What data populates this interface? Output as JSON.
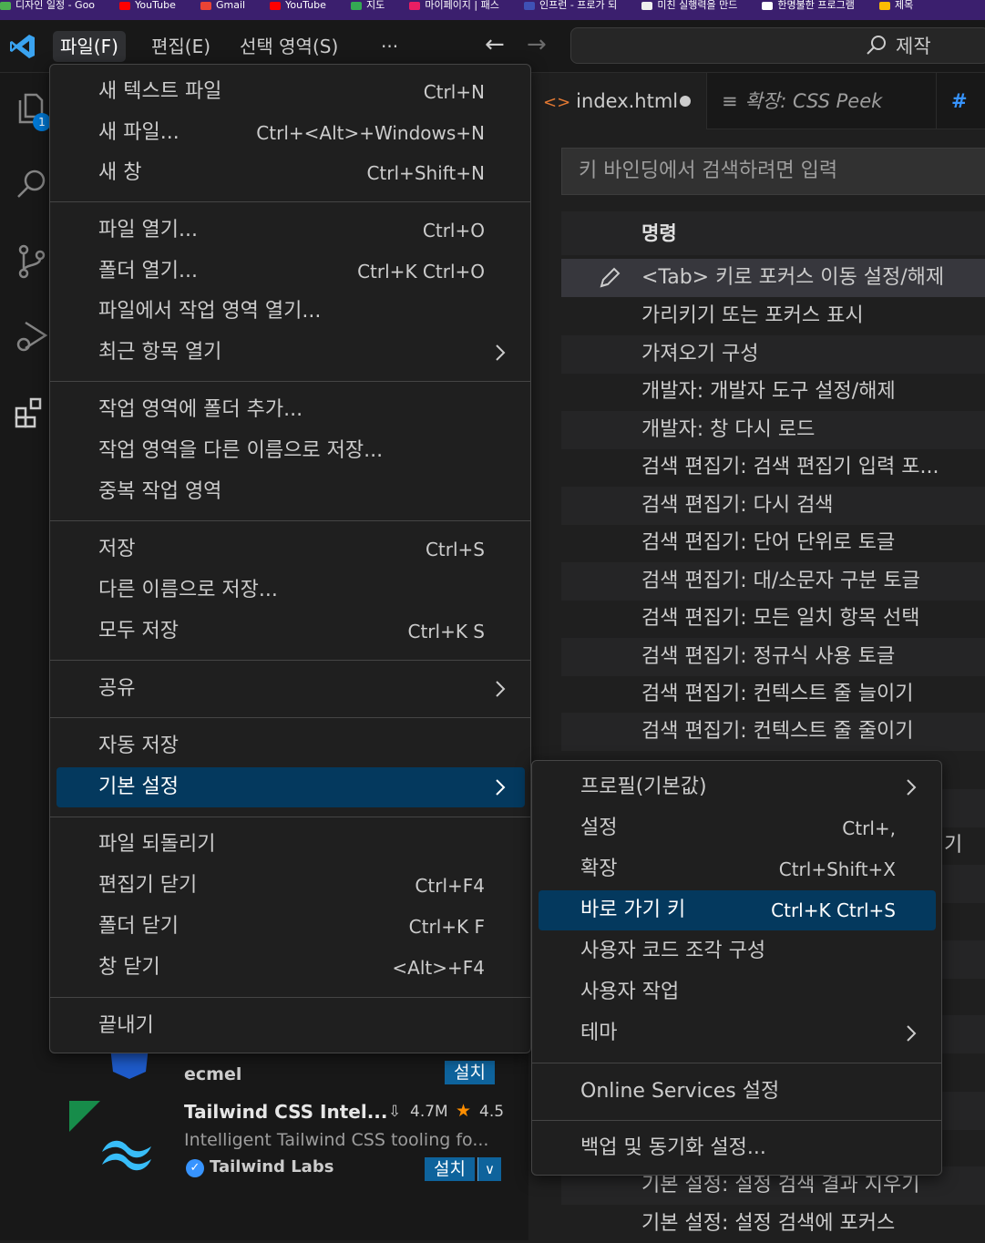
{
  "bookmarks": [
    {
      "label": "디자인 일정 - Goo",
      "color": "#4caf50"
    },
    {
      "label": "YouTube",
      "color": "#ff0000"
    },
    {
      "label": "Gmail",
      "color": "#ea4335"
    },
    {
      "label": "YouTube",
      "color": "#ff0000"
    },
    {
      "label": "지도",
      "color": "#34a853"
    },
    {
      "label": "마이페이지 | 패스",
      "color": "#e91e63"
    },
    {
      "label": "인프런 - 프로가 되",
      "color": "#3f51b5"
    },
    {
      "label": "미친 실행력을 만드",
      "color": "#eeeeee"
    },
    {
      "label": "한명불한 프로그램",
      "color": "#ffffff"
    },
    {
      "label": "제목",
      "color": "#fbbc04"
    }
  ],
  "titlebar": {
    "menus": {
      "file": "파일(F)",
      "edit": "편집(E)",
      "selection": "선택 영역(S)",
      "more": "···"
    },
    "search_label": "제작"
  },
  "activity": {
    "badge": "1"
  },
  "tabs": [
    {
      "label": "index.html",
      "icon": "<>"
    },
    {
      "label": "확장: CSS Peek",
      "icon": "≡"
    },
    {
      "label": "#",
      "icon": ""
    }
  ],
  "keybindings": {
    "search_placeholder": "키 바인딩에서 검색하려면 입력",
    "header": "명령",
    "rows": [
      "<Tab> 키로 포커스 이동 설정/해제",
      "가리키기 또는 포커스 표시",
      "가져오기 구성",
      "개발자: 개발자 도구 설정/해제",
      "개발자: 창 다시 로드",
      "검색 편집기: 검색 편집기 입력 포...",
      "검색 편집기: 다시 검색",
      "검색 편집기: 단어 단위로 토글",
      "검색 편집기: 대/소문자 구분 토글",
      "검색 편집기: 모든 일치 항목 선택",
      "검색 편집기: 정규식 사용 토글",
      "검색 편집기: 컨텍스트 줄 늘이기",
      "검색 편집기: 컨텍스트 줄 줄이기"
    ],
    "bottom_rows": [
      "기본 설정: 설정 검색 결과 지우기",
      "기본 설정: 설정 검색에 포커스"
    ],
    "partial_right": "기"
  },
  "extensions": [
    {
      "publisher": "ecmel",
      "install": "설치"
    },
    {
      "name": "Tailwind CSS Intel...",
      "downloads": "4.7M",
      "rating": "4.5",
      "description": "Intelligent Tailwind CSS tooling fo...",
      "publisher": "Tailwind Labs",
      "install": "설치"
    }
  ],
  "file_menu": {
    "items": [
      {
        "label": "새 텍스트 파일",
        "key": "Ctrl+N"
      },
      {
        "label": "새 파일...",
        "key": "Ctrl+<Alt>+Windows+N"
      },
      {
        "label": "새 창",
        "key": "Ctrl+Shift+N"
      },
      {
        "label": "파일 열기...",
        "key": "Ctrl+O"
      },
      {
        "label": "폴더 열기...",
        "key": "Ctrl+K Ctrl+O"
      },
      {
        "label": "파일에서 작업 영역 열기...",
        "key": ""
      },
      {
        "label": "최근 항목 열기",
        "key": ""
      },
      {
        "label": "작업 영역에 폴더 추가...",
        "key": ""
      },
      {
        "label": "작업 영역을 다른 이름으로 저장...",
        "key": ""
      },
      {
        "label": "중복 작업 영역",
        "key": ""
      },
      {
        "label": "저장",
        "key": "Ctrl+S"
      },
      {
        "label": "다른 이름으로 저장...",
        "key": ""
      },
      {
        "label": "모두 저장",
        "key": "Ctrl+K S"
      },
      {
        "label": "공유",
        "key": ""
      },
      {
        "label": "자동 저장",
        "key": ""
      },
      {
        "label": "기본 설정",
        "key": ""
      },
      {
        "label": "파일 되돌리기",
        "key": ""
      },
      {
        "label": "편집기 닫기",
        "key": "Ctrl+F4"
      },
      {
        "label": "폴더 닫기",
        "key": "Ctrl+K F"
      },
      {
        "label": "창 닫기",
        "key": "<Alt>+F4"
      },
      {
        "label": "끝내기",
        "key": ""
      }
    ]
  },
  "preferences_menu": {
    "items": [
      {
        "label": "프로필(기본값)",
        "key": ""
      },
      {
        "label": "설정",
        "key": "Ctrl+,"
      },
      {
        "label": "확장",
        "key": "Ctrl+Shift+X"
      },
      {
        "label": "바로 가기 키",
        "key": "Ctrl+K Ctrl+S"
      },
      {
        "label": "사용자 코드 조각 구성",
        "key": ""
      },
      {
        "label": "사용자 작업",
        "key": ""
      },
      {
        "label": "테마",
        "key": ""
      },
      {
        "label": "Online Services 설정",
        "key": ""
      },
      {
        "label": "백업 및 동기화 설정...",
        "key": ""
      }
    ]
  }
}
